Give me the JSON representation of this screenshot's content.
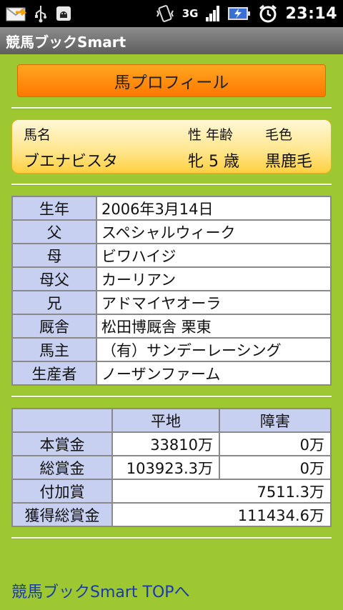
{
  "statusbar": {
    "left_icons": [
      "mail-icon",
      "usb-icon",
      "android-debug-icon"
    ],
    "network_label": "3G",
    "time": "23:14"
  },
  "app": {
    "title": "競馬ブックSmart"
  },
  "header": {
    "label": "馬プロフィール"
  },
  "horse": {
    "name_header": "馬名",
    "sex_age_header": "性 年齢",
    "color_header": "毛色",
    "name": "ブエナビスタ",
    "sex_age": "牝 5 歳",
    "color": "黒鹿毛"
  },
  "profile": [
    {
      "label": "生年",
      "value": "2006年3月14日"
    },
    {
      "label": "父",
      "value": "スペシャルウィーク"
    },
    {
      "label": "母",
      "value": "ビワハイジ"
    },
    {
      "label": "母父",
      "value": "カーリアン"
    },
    {
      "label": "兄",
      "value": "アドマイヤオーラ"
    },
    {
      "label": "厩舎",
      "value": "松田博厩舎 栗東"
    },
    {
      "label": "馬主",
      "value": "（有）サンデーレーシング"
    },
    {
      "label": "生産者",
      "value": "ノーザンファーム"
    }
  ],
  "prize": {
    "col_flat": "平地",
    "col_jump": "障害",
    "rows": [
      {
        "label": "本賞金",
        "flat": "33810万",
        "jump": "0万"
      },
      {
        "label": "総賞金",
        "flat": "103923.3万",
        "jump": "0万"
      }
    ],
    "additional_label": "付加賞",
    "additional_value": "7511.3万",
    "total_label": "獲得総賞金",
    "total_value": "111434.6万"
  },
  "footer": {
    "top_link": "競馬ブックSmart TOPへ"
  }
}
